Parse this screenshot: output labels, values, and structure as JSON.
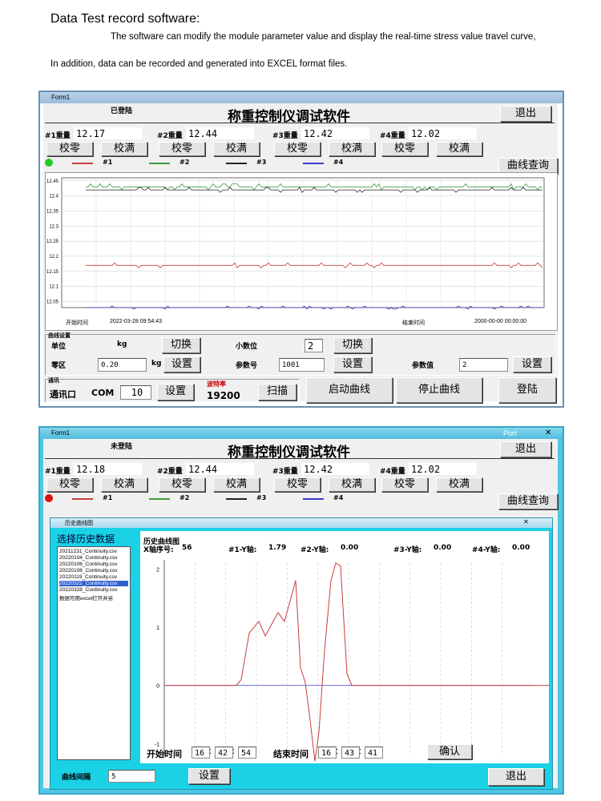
{
  "intro": {
    "heading": "Data Test record software:",
    "line1": "The software can modify the module parameter value and display the real-time stress value travel curve,",
    "line2": "In addition, data can be recorded and generated into EXCEL format files."
  },
  "win1": {
    "form_title": "Form1",
    "status": "已登陆",
    "app_title": "称重控制仪调试软件",
    "exit": "退出",
    "weights": [
      {
        "label": "#1重量",
        "value": "12.17"
      },
      {
        "label": "#2重量",
        "value": "12.44"
      },
      {
        "label": "#3重量",
        "value": "12.42"
      },
      {
        "label": "#4重量",
        "value": "12.02"
      }
    ],
    "zero_btn": "校零",
    "full_btn": "校满",
    "curve_query": "曲线查询",
    "legend": [
      "#1",
      "#2",
      "#3",
      "#4"
    ],
    "series_colors": [
      "#c83c3c",
      "#3c9b3c",
      "#222222",
      "#3c3cc8"
    ],
    "chart": {
      "y_ticks": [
        "12.45",
        "12.4",
        "12.35",
        "12.3",
        "12.25",
        "12.2",
        "12.15",
        "12.1",
        "12.05"
      ],
      "start_label": "开始时间",
      "start_time": "2022-03-28 09:54:43",
      "end_label": "结束时间",
      "end_time": "2000-00-00 00:00:00"
    },
    "curve_settings": {
      "group": "曲线设置",
      "unit_label": "单位",
      "unit_value": "kg",
      "switch": "切换",
      "decimal_label": "小数位",
      "decimal_value": "2",
      "zero_label": "零区",
      "zero_value": "0.20",
      "zero_unit": "kg",
      "set": "设置",
      "param_no_label": "参数号",
      "param_no_value": "1001",
      "param_val_label": "参数值",
      "param_val_value": "2"
    },
    "comm": {
      "group": "通讯",
      "port_label": "通讯口",
      "com_label": "COM",
      "com_value": "10",
      "set": "设置",
      "baud_label": "波特率",
      "baud_value": "19200",
      "scan": "扫描"
    },
    "start_curve": "启动曲线",
    "stop_curve": "停止曲线",
    "login": "登陆"
  },
  "win2": {
    "form_title": "Form1",
    "port_tag": "Port",
    "status": "未登陆",
    "app_title": "称重控制仪调试软件",
    "exit": "退出",
    "weights": [
      {
        "label": "#1重量",
        "value": "12.18"
      },
      {
        "label": "#2重量",
        "value": "12.44"
      },
      {
        "label": "#3重量",
        "value": "12.42"
      },
      {
        "label": "#4重量",
        "value": "12.02"
      }
    ],
    "zero_btn": "校零",
    "full_btn": "校满",
    "curve_query": "曲线查询",
    "legend": [
      "#1",
      "#2",
      "#3",
      "#4"
    ],
    "history": {
      "title": "历史曲线图",
      "select_label": "选择历史数据",
      "files": [
        "20211231_Continuity.csv",
        "20220104_Continuity.csv",
        "20220106_Continuity.csv",
        "20220108_Continuity.csv",
        "20220119_Continuity.csv",
        "20220322_Continuity.csv",
        "20220328_Continuity.csv",
        "数据可用excel打开并另"
      ],
      "chart_title": "历史曲线图",
      "x_index_label": "X轴序号:",
      "x_index_value": "56",
      "y1_label": "#1-Y轴:",
      "y1_value": "1.79",
      "y2_label": "#2-Y轴:",
      "y2_value": "0.00",
      "y3_label": "#3-Y轴:",
      "y3_value": "0.00",
      "y4_label": "#4-Y轴:",
      "y4_value": "0.00",
      "y_ticks": [
        "2",
        "1",
        "0",
        "-1"
      ],
      "start_label": "开始时间",
      "start_h": "16",
      "start_m": "42",
      "start_s": "54",
      "end_label": "结束时间",
      "end_h": "16",
      "end_m": "43",
      "end_s": "41",
      "confirm": "确认",
      "interval_label": "曲线间隔",
      "interval_value": "5",
      "set": "设置",
      "exit": "退出"
    }
  }
}
